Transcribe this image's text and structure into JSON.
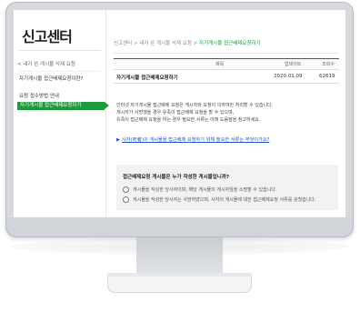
{
  "sidebar": {
    "brand": "신고센터",
    "back": "< 내가 쓴 게시물 삭제 요청",
    "items": [
      {
        "label": "자기게시물 접근배제요청이란?"
      },
      {
        "label": "요청 접수방법 안내"
      },
      {
        "label": "자기게시물 접근배제요청하기"
      }
    ]
  },
  "breadcrumb": {
    "path": "신고센터 > 내가 쓴 게시물 삭제 요청 > ",
    "current": "자기게시물 접근배제요청하기"
  },
  "table": {
    "headers": {
      "title": "제목",
      "date": "업데이트",
      "views": "조회수"
    },
    "row": {
      "title": "자기게시물 접근배제요청하기",
      "date": "2020.01.09",
      "views": "62619"
    }
  },
  "body": {
    "line1": "인터넷 자기게시물 접근배제 요청은 게시자와 요청이 의하여만 처리할 수 있습니다.",
    "line2": "게시자가 사망했을 경우 유족이 접근배제 요청을 할 수 있으며,",
    "line3": "유족이 접근배제 요청을 하는 경우 필요한 서류는 아래 도움말을 참고하세요.",
    "link": "사자(死者)의 게시물을 접근배제 요청하기 위해 필요한 서류는 무엇이가요?"
  },
  "question": {
    "title": "접근배제요청 게시물은 누가 작성한 게시물입니까?",
    "options": [
      "게시물을 작성한 당사자이며, 해당 게시물의 게시자임을 소명할 수 있습니다.",
      "게시물을 작성한 당사자는 사망하였으며, 사자의 게시물에 대한 접근배제요청 서류를 갖췄습니다."
    ]
  },
  "colors": {
    "accent": "#1d9a3c",
    "link": "#2255cc"
  }
}
